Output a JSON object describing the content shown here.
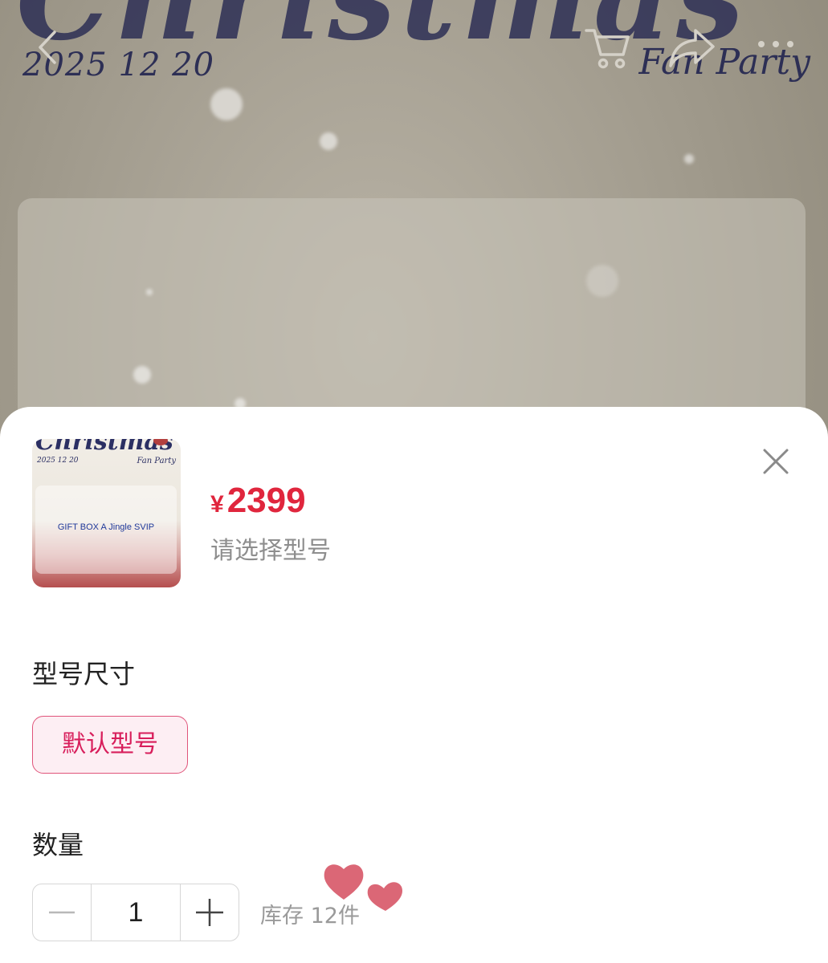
{
  "background": {
    "title_script": "Christmas",
    "date": "2025 12 20",
    "tagline": "Fan Party"
  },
  "nav": {
    "back_icon": "chevron-left-icon",
    "cart_icon": "cart-icon",
    "share_icon": "share-icon",
    "more_icon": "more-dots-icon"
  },
  "sheet": {
    "thumbnail": {
      "title": "Christmas",
      "date": "2025 12 20",
      "tagline": "Fan Party",
      "caption": "GIFT BOX A Jingle SVIP"
    },
    "price": {
      "symbol": "¥",
      "value": "2399"
    },
    "select_hint": "请选择型号",
    "close_icon": "close-icon",
    "model_section": {
      "label": "型号尺寸",
      "options": [
        {
          "label": "默认型号",
          "selected": true
        }
      ]
    },
    "quantity_section": {
      "label": "数量",
      "value": "1",
      "decrement_icon": "minus-icon",
      "increment_icon": "plus-icon",
      "stock": "库存 12件"
    }
  },
  "colors": {
    "accent_price": "#e0263d",
    "chip_border": "#e0547a",
    "chip_bg": "#fdeef3",
    "chip_text": "#d81e5b",
    "overlay_bg": "#9f998b"
  }
}
